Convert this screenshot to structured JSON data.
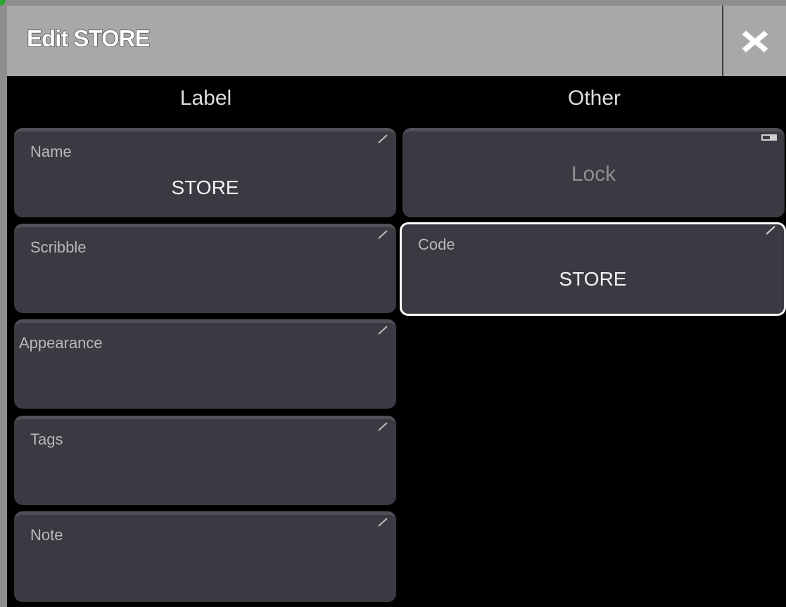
{
  "window": {
    "title": "Edit STORE",
    "close_icon": "close-x-icon"
  },
  "columns": {
    "label_header": "Label",
    "other_header": "Other"
  },
  "label_fields": [
    {
      "label": "Name",
      "value": "STORE"
    },
    {
      "label": "Scribble",
      "value": ""
    },
    {
      "label": "Appearance",
      "value": ""
    },
    {
      "label": "Tags",
      "value": ""
    },
    {
      "label": "Note",
      "value": ""
    }
  ],
  "other_fields": {
    "lock": {
      "label": "Lock",
      "state": "off"
    },
    "code": {
      "label": "Code",
      "value": "STORE",
      "selected": true
    }
  },
  "colors": {
    "titlebar": "#a8a8a8",
    "field_bg": "#3a3a42",
    "selected_border": "#ffffff",
    "background": "#000000"
  }
}
